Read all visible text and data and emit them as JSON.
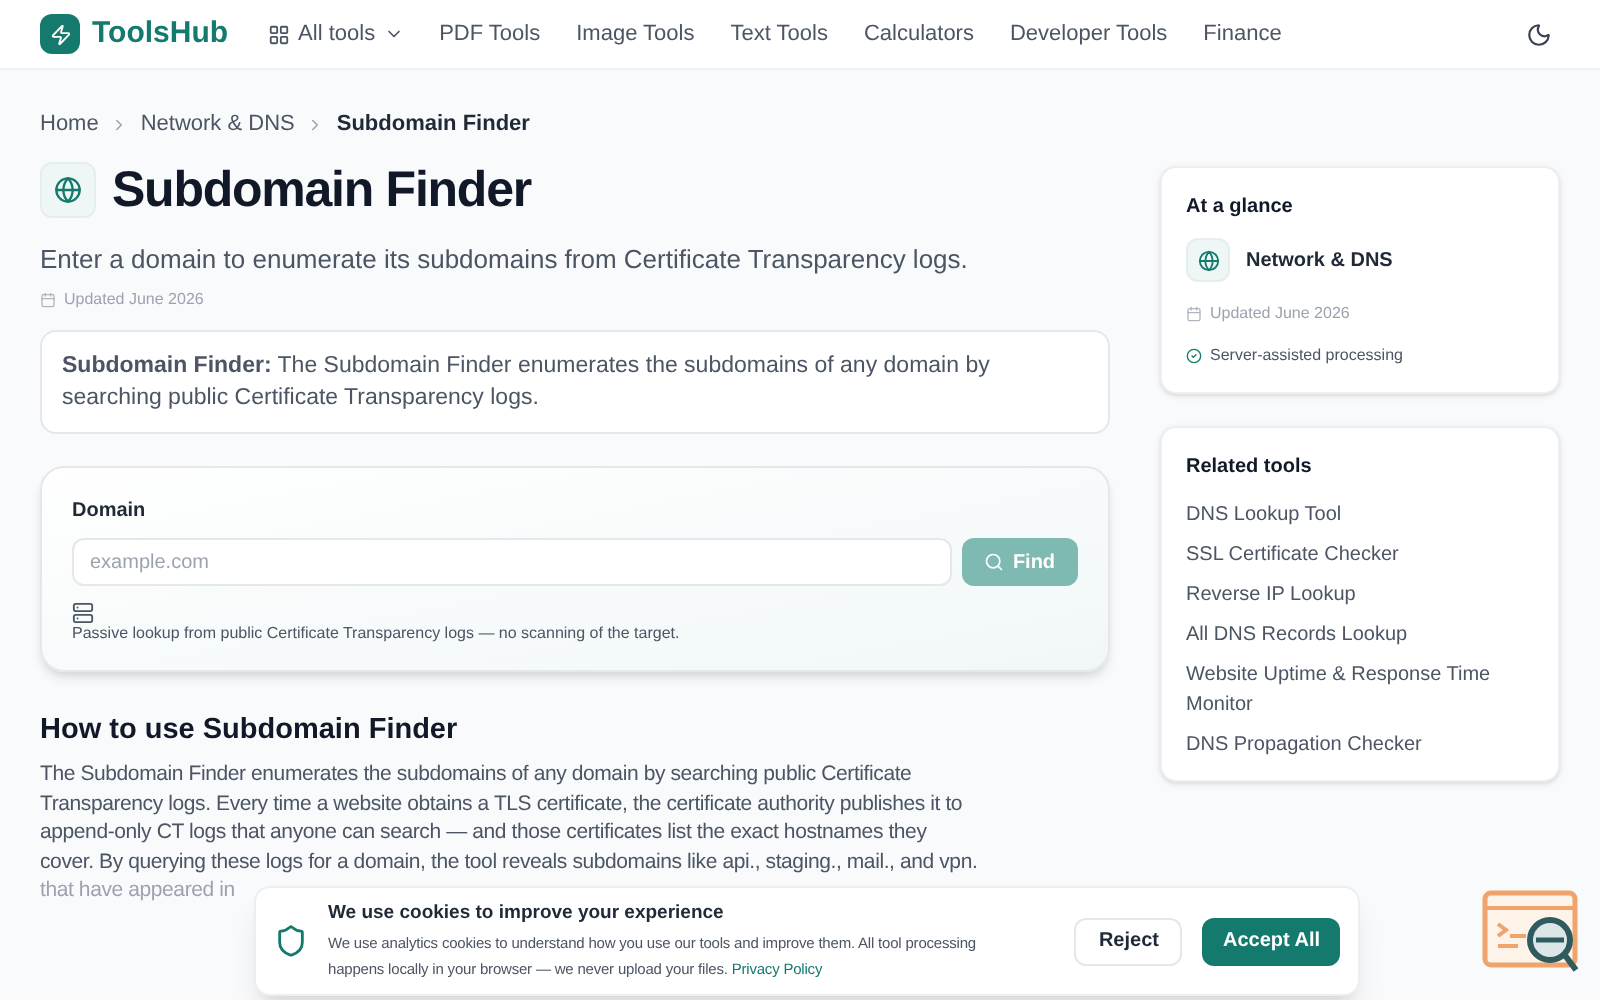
{
  "header": {
    "logo": "ToolsHub",
    "nav": [
      {
        "label": "All tools",
        "kind": "menu"
      },
      {
        "label": "PDF Tools",
        "kind": "link"
      },
      {
        "label": "Image Tools",
        "kind": "link"
      },
      {
        "label": "Text Tools",
        "kind": "link"
      },
      {
        "label": "Calculators",
        "kind": "link"
      },
      {
        "label": "Developer Tools",
        "kind": "link"
      },
      {
        "label": "Finance",
        "kind": "link"
      }
    ]
  },
  "breadcrumb": [
    "Home",
    "Network & DNS",
    "Subdomain Finder"
  ],
  "title": "Subdomain Finder",
  "subtitle": "Enter a domain to enumerate its subdomains from Certificate Transparency logs.",
  "updated": "Updated June 2026",
  "summary": "**Subdomain Finder:** The Subdomain Finder enumerates the subdomains of any domain by searching public Certificate Transparency logs.",
  "form": {
    "label": "Domain",
    "placeholder": "example.com",
    "button": "Find",
    "button_disabled": true,
    "note": "Passive lookup from public Certificate Transparency logs — no scanning of the target."
  },
  "how_to": {
    "heading": "How to use Subdomain Finder",
    "lines": [
      "The Subdomain Finder enumerates the subdomains of any domain by searching public Certificate",
      "Transparency logs. Every time a website obtains a TLS certificate, the certificate authority publishes it to",
      "append-only CT logs that anyone can search — and those certificates list the exact hostnames they",
      "cover. By querying these logs for a domain, the tool reveals subdomains like api., staging., mail., and vpn.",
      "that have appeared in"
    ]
  },
  "glance": {
    "title": "At a glance",
    "category": "Network & DNS",
    "updated": "Updated June 2026",
    "processing": "Server-assisted processing"
  },
  "related": {
    "title": "Related tools",
    "items": [
      "DNS Lookup Tool",
      "SSL Certificate Checker",
      "Reverse IP Lookup",
      "All DNS Records Lookup",
      "Website Uptime & Response Time Monitor",
      "DNS Propagation Checker"
    ]
  },
  "cookie": {
    "title": "We use cookies to improve your experience",
    "text": "We use analytics cookies to understand how you use our tools and improve them. All tool processing happens locally in your browser — we never upload your files.",
    "link": "Privacy Policy",
    "reject": "Reject",
    "accept": "Accept All"
  }
}
